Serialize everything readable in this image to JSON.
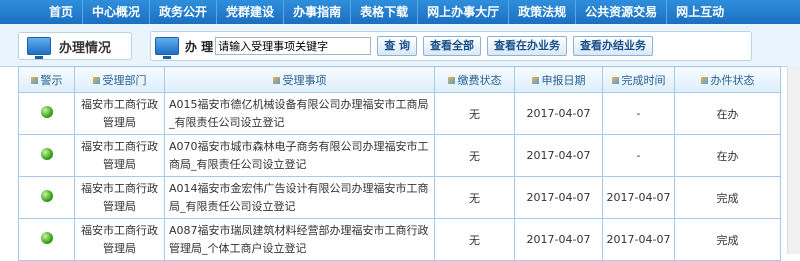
{
  "nav": [
    "首页",
    "中心概况",
    "政务公开",
    "党群建设",
    "办事指南",
    "表格下载",
    "网上办事大厅",
    "政策法规",
    "公共资源交易",
    "网上互动"
  ],
  "panel": {
    "title": "办理情况",
    "search_label": "办 理",
    "search_placeholder": "请输入受理事项关键字",
    "buttons": [
      "查 询",
      "查看全部",
      "查看在办业务",
      "查看办结业务"
    ]
  },
  "table": {
    "headers": [
      "警示",
      "受理部门",
      "受理事项",
      "缴费状态",
      "申报日期",
      "完成时间",
      "办件状态"
    ],
    "rows": [
      {
        "dept": "福安市工商行政管理局",
        "item": "A015福安市德亿机械设备有限公司办理福安市工商局_有限责任公司设立登记",
        "fee": "无",
        "date": "2017-04-07",
        "done": "-",
        "status": "在办"
      },
      {
        "dept": "福安市工商行政管理局",
        "item": "A070福安市城市森林电子商务有限公司办理福安市工商局_有限责任公司设立登记",
        "fee": "无",
        "date": "2017-04-07",
        "done": "-",
        "status": "在办"
      },
      {
        "dept": "福安市工商行政管理局",
        "item": "A014福安市金宏伟广告设计有限公司办理福安市工商局_有限责任公司设立登记",
        "fee": "无",
        "date": "2017-04-07",
        "done": "2017-04-07",
        "status": "完成"
      },
      {
        "dept": "福安市工商行政管理局",
        "item": "A087福安市瑞凤建筑材料经营部办理福安市工商行政管理局_个体工商户设立登记",
        "fee": "无",
        "date": "2017-04-07",
        "done": "2017-04-07",
        "status": "完成"
      }
    ]
  }
}
